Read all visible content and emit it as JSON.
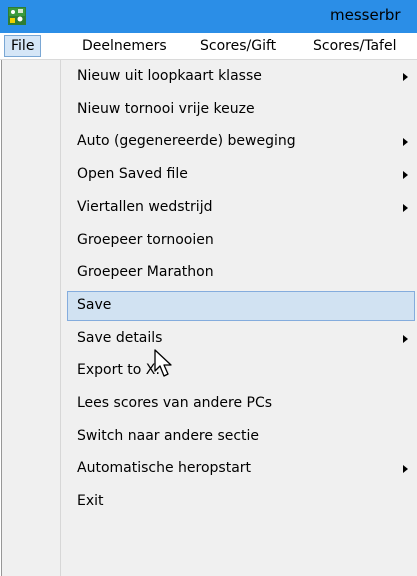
{
  "window": {
    "title": "messerbr",
    "icon": "app-icon"
  },
  "menubar": {
    "items": [
      "File",
      "Deelnemers",
      "Scores/Gift",
      "Scores/Tafel"
    ],
    "active": "File"
  },
  "file_menu": {
    "items": [
      {
        "label": "Nieuw uit loopkaart klasse",
        "submenu": true
      },
      {
        "label": "Nieuw tornooi vrije keuze",
        "submenu": false
      },
      {
        "label": "Auto (gegenereerde) beweging",
        "submenu": true
      },
      {
        "label": "Open Saved file",
        "submenu": true
      },
      {
        "label": "Viertallen wedstrijd",
        "submenu": true
      },
      {
        "label": "Groepeer tornooien",
        "submenu": false
      },
      {
        "label": "Groepeer Marathon",
        "submenu": false
      },
      {
        "label": "Save",
        "submenu": false,
        "highlighted": true
      },
      {
        "label": "Save details",
        "submenu": true
      },
      {
        "label": "Export to X:",
        "submenu": false
      },
      {
        "label": "Lees scores van andere PCs",
        "submenu": false
      },
      {
        "label": "Switch naar andere sectie",
        "submenu": false
      },
      {
        "label": "Automatische heropstart",
        "submenu": true
      },
      {
        "label": "Exit",
        "submenu": false
      }
    ]
  },
  "colors": {
    "titlebar": "#2b8ee7",
    "menu_background": "#f0f0f0",
    "highlight": "#d1e2f2",
    "highlight_border": "#84acdd"
  }
}
